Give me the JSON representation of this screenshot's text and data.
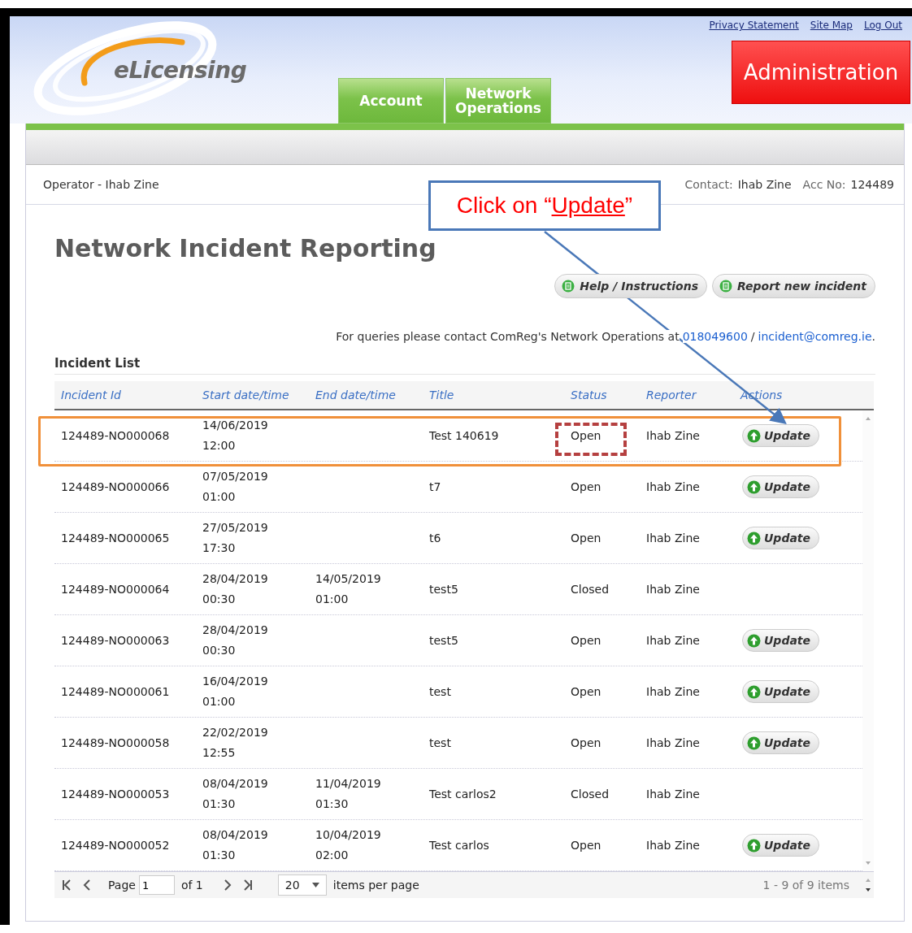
{
  "header": {
    "logo": "eLicensing",
    "top_links": [
      "Privacy Statement",
      "Site Map",
      "Log Out"
    ],
    "tabs": [
      {
        "label": "Account"
      },
      {
        "label": "Network Operations"
      }
    ],
    "admin_button": "Administration"
  },
  "info_bar": {
    "operator": "Operator - Ihab Zine",
    "contact_label": "Contact:",
    "contact": "Ihab Zine",
    "acc_label": "Acc No:",
    "acc": "124489"
  },
  "page_title": "Network Incident Reporting",
  "buttons": [
    "Help / Instructions",
    "Report new incident"
  ],
  "contact_note": {
    "text": "For queries please contact ComReg's Network Operations at",
    "phone": "018049600",
    "separator": "/",
    "email": "incident@comreg.ie",
    "end": "."
  },
  "incident_list": {
    "title": "Incident List",
    "columns": [
      "Incident Id",
      "Start date/time",
      "End date/time",
      "Title",
      "Status",
      "Reporter",
      "Actions"
    ],
    "rows": [
      {
        "id": "124489-NO000068",
        "start": [
          "14/06/2019",
          "12:00"
        ],
        "end": [],
        "title": "Test 140619",
        "status": "Open",
        "reporter": "Ihab Zine",
        "action": "Update"
      },
      {
        "id": "124489-NO000066",
        "start": [
          "07/05/2019",
          "01:00"
        ],
        "end": [],
        "title": "t7",
        "status": "Open",
        "reporter": "Ihab Zine",
        "action": "Update"
      },
      {
        "id": "124489-NO000065",
        "start": [
          "27/05/2019",
          "17:30"
        ],
        "end": [],
        "title": "t6",
        "status": "Open",
        "reporter": "Ihab Zine",
        "action": "Update"
      },
      {
        "id": "124489-NO000064",
        "start": [
          "28/04/2019",
          "00:30"
        ],
        "end": [
          "14/05/2019",
          "01:00"
        ],
        "title": "test5",
        "status": "Closed",
        "reporter": "Ihab Zine"
      },
      {
        "id": "124489-NO000063",
        "start": [
          "28/04/2019",
          "00:30"
        ],
        "end": [],
        "title": "test5",
        "status": "Open",
        "reporter": "Ihab Zine",
        "action": "Update"
      },
      {
        "id": "124489-NO000061",
        "start": [
          "16/04/2019",
          "01:00"
        ],
        "end": [],
        "title": "test",
        "status": "Open",
        "reporter": "Ihab Zine",
        "action": "Update"
      },
      {
        "id": "124489-NO000058",
        "start": [
          "22/02/2019",
          "12:55"
        ],
        "end": [],
        "title": "test",
        "status": "Open",
        "reporter": "Ihab Zine",
        "action": "Update"
      },
      {
        "id": "124489-NO000053",
        "start": [
          "08/04/2019",
          "01:30"
        ],
        "end": [
          "11/04/2019",
          "01:30"
        ],
        "title": "Test carlos2",
        "status": "Closed",
        "reporter": "Ihab Zine"
      },
      {
        "id": "124489-NO000052",
        "start": [
          "08/04/2019",
          "01:30"
        ],
        "end": [
          "10/04/2019",
          "02:00"
        ],
        "title": "Test carlos",
        "status": "Open",
        "reporter": "Ihab Zine",
        "action": "Update"
      }
    ],
    "pager": {
      "page_label": "Page",
      "page": "1",
      "of": "of 1",
      "page_size": "20",
      "per_page": "items per page",
      "summary": "1 - 9 of 9 items"
    }
  },
  "annotation": {
    "prefix": "Click on “",
    "link": "Update",
    "suffix": "”"
  }
}
